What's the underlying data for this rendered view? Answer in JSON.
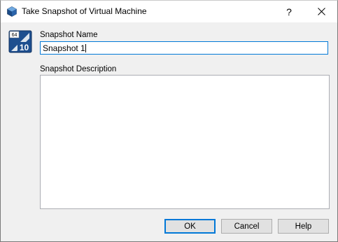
{
  "window": {
    "title": "Take Snapshot of Virtual Machine",
    "help_glyph": "?",
    "close_glyph": "✕"
  },
  "vm_icon": {
    "badge_top": "64",
    "badge_number": "10"
  },
  "form": {
    "name_label": "Snapshot Name",
    "name_value": "Snapshot 1",
    "description_label": "Snapshot Description",
    "description_value": ""
  },
  "buttons": {
    "ok_label": "OK",
    "cancel_label": "Cancel",
    "help_label": "Help"
  },
  "colors": {
    "focus_accent": "#0078d7",
    "dialog_background": "#f0f0f0"
  }
}
